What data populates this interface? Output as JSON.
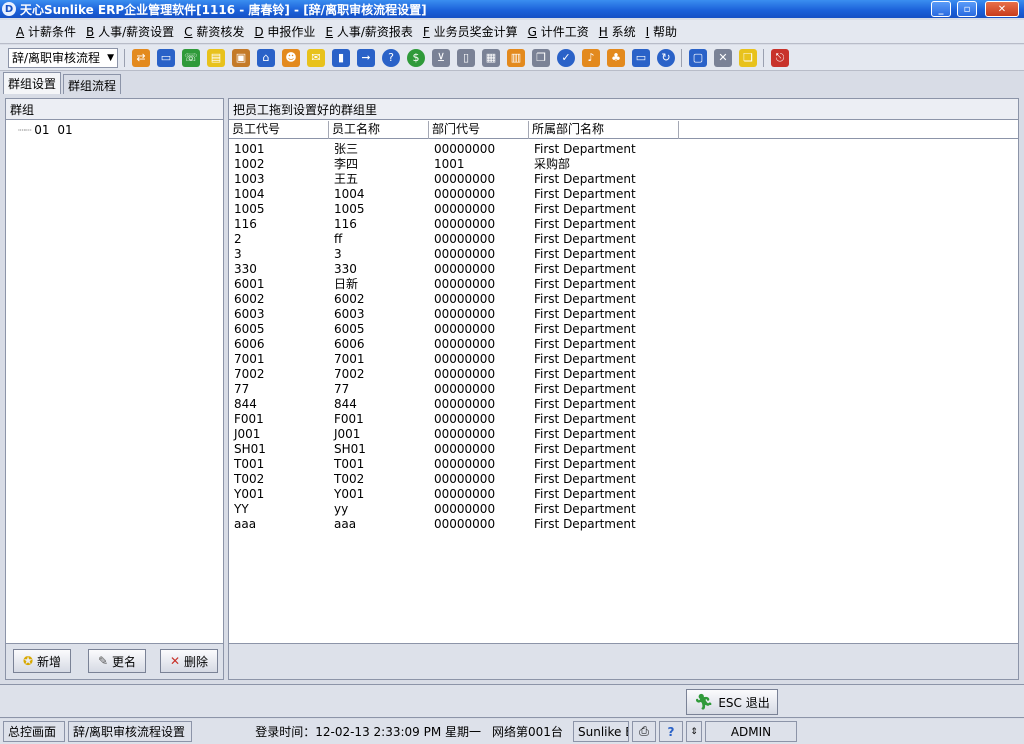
{
  "window": {
    "title": "天心Sunlike ERP企业管理软件[1116 - 唐春铃] - [辞/离职审核流程设置]",
    "app_icon": "app-logo-icon",
    "minimize_glyph": "_",
    "maximize_glyph": "▫",
    "close_glyph": "✕"
  },
  "menu": {
    "items": [
      {
        "key": "A",
        "label": " 计薪条件"
      },
      {
        "key": "B",
        "label": " 人事/薪资设置"
      },
      {
        "key": "C",
        "label": " 薪资核发"
      },
      {
        "key": "D",
        "label": " 申报作业"
      },
      {
        "key": "E",
        "label": " 人事/薪资报表"
      },
      {
        "key": "F",
        "label": " 业务员奖金计算"
      },
      {
        "key": "G",
        "label": " 计件工资"
      },
      {
        "key": "H",
        "label": " 系统"
      },
      {
        "key": "I",
        "label": " 帮助"
      }
    ]
  },
  "toolbar": {
    "flow_select_value": "辞/离职审核流程",
    "icon_colors": {
      "blue": "#2a62c8",
      "green": "#2f9a3a",
      "orange": "#e38a1e",
      "red": "#c8322a",
      "yellow": "#e8c21c",
      "gray": "#7a8296"
    }
  },
  "tabs": [
    {
      "label": "群组设置",
      "active": true
    },
    {
      "label": "群组流程",
      "active": false
    }
  ],
  "left_panel": {
    "header": "群组",
    "tree": [
      {
        "code": "01",
        "name": "01"
      }
    ],
    "buttons": {
      "add": "新增",
      "rename": "更名",
      "delete": "删除"
    }
  },
  "right_panel": {
    "header": "把员工拖到设置好的群组里",
    "columns": [
      "员工代号",
      "员工名称",
      "部门代号",
      "所属部门名称"
    ],
    "rows": [
      [
        "1001",
        "张三",
        "00000000",
        "First Department"
      ],
      [
        "1002",
        "李四",
        "1001",
        "采购部"
      ],
      [
        "1003",
        "王五",
        "00000000",
        "First Department"
      ],
      [
        "1004",
        "1004",
        "00000000",
        "First Department"
      ],
      [
        "1005",
        "1005",
        "00000000",
        "First Department"
      ],
      [
        "116",
        "116",
        "00000000",
        "First Department"
      ],
      [
        "2",
        "ff",
        "00000000",
        "First Department"
      ],
      [
        "3",
        "3",
        "00000000",
        "First Department"
      ],
      [
        "330",
        "330",
        "00000000",
        "First Department"
      ],
      [
        "6001",
        "日新",
        "00000000",
        "First Department"
      ],
      [
        "6002",
        "6002",
        "00000000",
        "First Department"
      ],
      [
        "6003",
        "6003",
        "00000000",
        "First Department"
      ],
      [
        "6005",
        "6005",
        "00000000",
        "First Department"
      ],
      [
        "6006",
        "6006",
        "00000000",
        "First Department"
      ],
      [
        "7001",
        "7001",
        "00000000",
        "First Department"
      ],
      [
        "7002",
        "7002",
        "00000000",
        "First Department"
      ],
      [
        "77",
        "77",
        "00000000",
        "First Department"
      ],
      [
        "844",
        "844",
        "00000000",
        "First Department"
      ],
      [
        "F001",
        "F001",
        "00000000",
        "First Department"
      ],
      [
        "J001",
        "J001",
        "00000000",
        "First Department"
      ],
      [
        "SH01",
        "SH01",
        "00000000",
        "First Department"
      ],
      [
        "T001",
        "T001",
        "00000000",
        "First Department"
      ],
      [
        "T002",
        "T002",
        "00000000",
        "First Department"
      ],
      [
        "Y001",
        "Y001",
        "00000000",
        "First Department"
      ],
      [
        "YY",
        "yy",
        "00000000",
        "First Department"
      ],
      [
        "aaa",
        "aaa",
        "00000000",
        "First Department"
      ]
    ]
  },
  "bottom": {
    "esc_label": "ESC 退出"
  },
  "status": {
    "home": "总控画面",
    "current": "辞/离职审核流程设置",
    "login_time": "登录时间：12-02-13 2:33:09 PM  星期一",
    "network": "网络第001台",
    "product": "Sunlike E",
    "user": "ADMIN"
  }
}
